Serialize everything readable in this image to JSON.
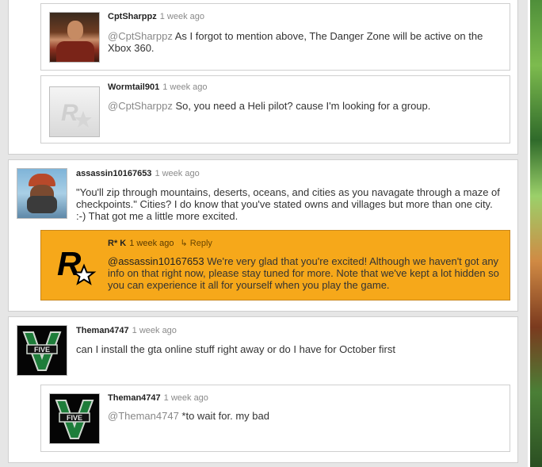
{
  "comments": [
    {
      "replies": [
        {
          "user": "CptSharppz",
          "time": "1 week ago",
          "mention": "@CptSharppz",
          "text": " As I forgot to mention above, The Danger Zone will be active on the Xbox 360.",
          "avatar": "person-avatar"
        },
        {
          "user": "Wormtail901",
          "time": "1 week ago",
          "mention": "@CptSharppz",
          "text": " So, you need a Heli pilot? cause I'm looking for a group.",
          "avatar": "rockstar-logo"
        }
      ]
    },
    {
      "user": "assassin10167653",
      "time": "1 week ago",
      "text": "\"You'll zip through mountains, deserts, oceans, and cities as you navagate through a maze of checkpoints.\" Cities? I do know that you've stated owns and villages but more than one city. :-) That got me a little more excited.",
      "avatar": "masked-person-avatar",
      "replies": [
        {
          "user": "R* K",
          "time": "1 week ago",
          "reply_label": "Reply",
          "mention": "@assassin10167653",
          "text": " We're very glad that you're excited! Although we haven't got any info on that right now, please stay tuned for more. Note that we've kept a lot hidden so you can experience it all for yourself when you play the game.",
          "avatar": "rockstar-logo",
          "highlight_color": "#f6a81a"
        }
      ]
    },
    {
      "user": "Theman4747",
      "time": "1 week ago",
      "text": "can I install the gta online stuff right away or do I have for October first",
      "avatar": "gta-v-logo",
      "replies": [
        {
          "user": "Theman4747",
          "time": "1 week ago",
          "mention": "@Theman4747",
          "text": " *to wait for. my bad",
          "avatar": "gta-v-logo"
        }
      ]
    }
  ],
  "colors": {
    "highlight": "#f6a81a",
    "border": "#cfcfcf",
    "background": "#e6e6e6"
  }
}
